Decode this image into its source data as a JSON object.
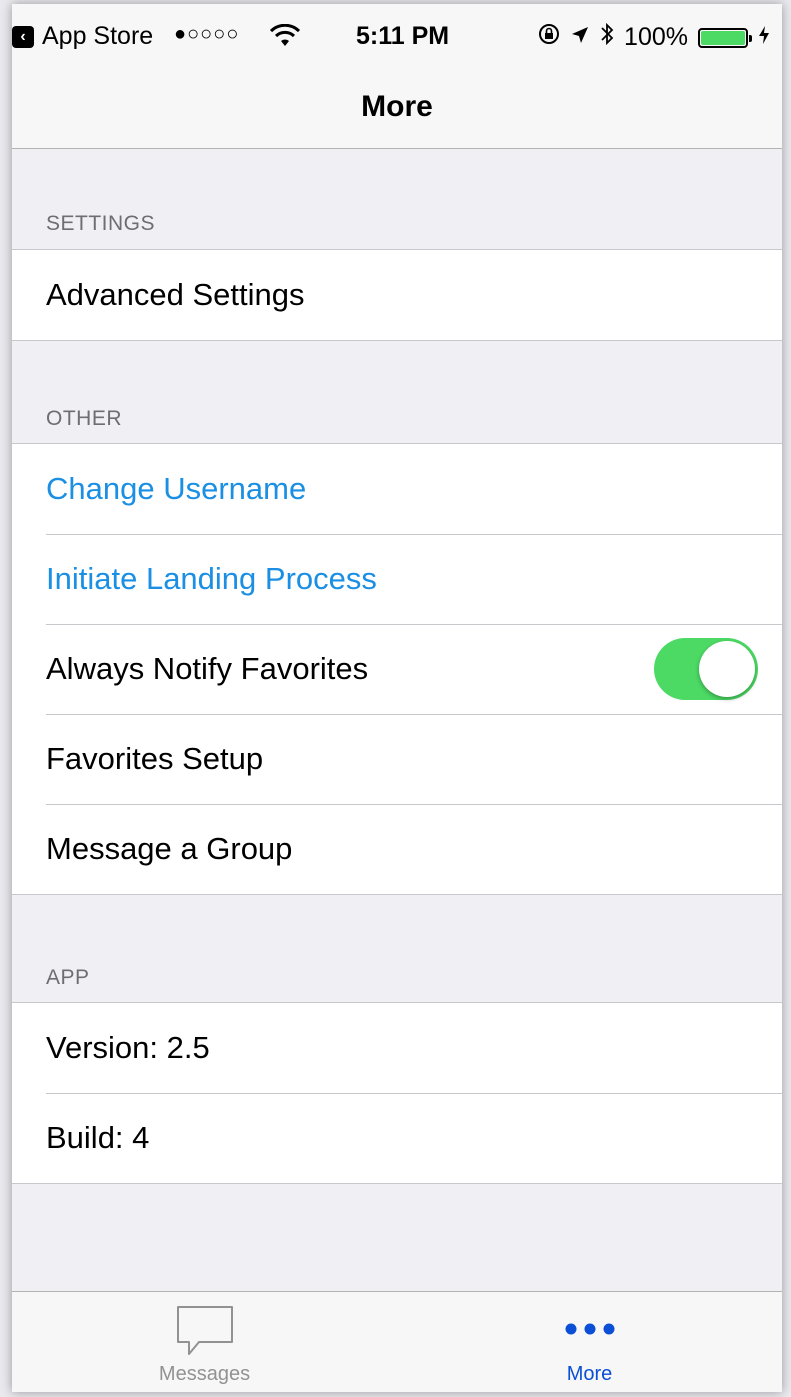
{
  "status_bar": {
    "back_app": "App Store",
    "signal": "●○○○○",
    "time": "5:11 PM",
    "battery_percent": "100%",
    "battery_level": 1.0
  },
  "nav": {
    "title": "More"
  },
  "sections": {
    "settings": {
      "header": "SETTINGS",
      "items": [
        "Advanced Settings"
      ]
    },
    "other": {
      "header": "OTHER",
      "items": [
        "Change Username",
        "Initiate Landing Process",
        "Always Notify Favorites",
        "Favorites Setup",
        "Message a Group"
      ],
      "toggle_on": true
    },
    "app": {
      "header": "APP",
      "items": [
        "Version: 2.5",
        "Build: 4"
      ]
    }
  },
  "tab_bar": {
    "tabs": [
      {
        "label": "Messages",
        "icon": "message-bubble-icon",
        "active": false
      },
      {
        "label": "More",
        "icon": "more-dots-icon",
        "active": true
      }
    ]
  },
  "colors": {
    "link": "#1a8fe3",
    "toggle_on": "#4cd964",
    "tab_active": "#0a4fd6",
    "tab_inactive": "#929292"
  }
}
